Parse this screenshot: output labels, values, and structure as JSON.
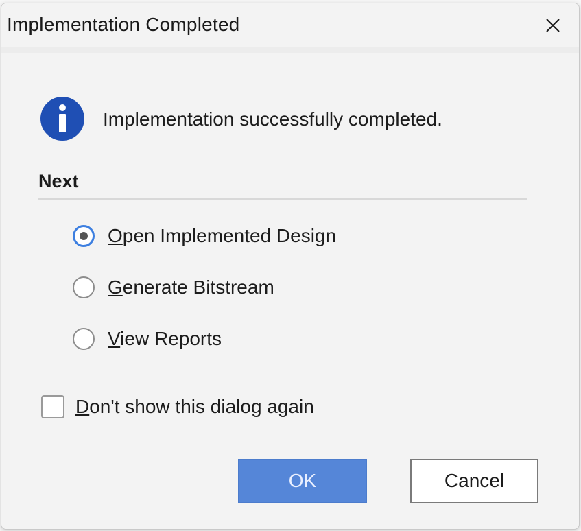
{
  "window": {
    "title": "Implementation Completed"
  },
  "message": "Implementation successfully completed.",
  "next_section": {
    "label": "Next",
    "options": [
      {
        "mnemonic": "O",
        "rest": "pen Implemented Design",
        "selected": true
      },
      {
        "mnemonic": "G",
        "rest": "enerate Bitstream",
        "selected": false
      },
      {
        "mnemonic": "V",
        "rest": "iew Reports",
        "selected": false
      }
    ]
  },
  "dont_show": {
    "mnemonic": "D",
    "rest": "on't show this dialog again",
    "checked": false
  },
  "buttons": {
    "ok": "OK",
    "cancel": "Cancel"
  },
  "colors": {
    "info_icon": "#1f4fb4",
    "ok_button": "#5586d8",
    "radio_selected_ring": "#3d7fe0"
  },
  "icons": {
    "info": "info-icon",
    "close": "close-icon"
  }
}
